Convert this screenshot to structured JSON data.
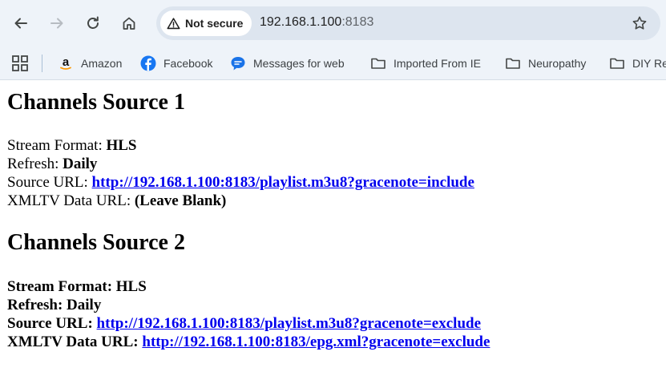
{
  "browser": {
    "security_label": "Not secure",
    "url_host": "192.168.1.100",
    "url_port": ":8183",
    "bookmarks": [
      {
        "label": "Amazon"
      },
      {
        "label": "Facebook"
      },
      {
        "label": "Messages for web"
      },
      {
        "label": "Imported From IE"
      },
      {
        "label": "Neuropathy"
      },
      {
        "label": "DIY Re"
      }
    ]
  },
  "sources": [
    {
      "heading": "Channels Source 1",
      "stream_format_label": "Stream Format: ",
      "stream_format_value": "HLS",
      "refresh_label": "Refresh: ",
      "refresh_value": "Daily",
      "source_url_label": "Source URL: ",
      "source_url_value": "http://192.168.1.100:8183/playlist.m3u8?gracenote=include",
      "xmltv_label": "XMLTV Data URL: ",
      "xmltv_value": "(Leave Blank)"
    },
    {
      "heading": "Channels Source 2",
      "stream_format_label": "Stream Format: ",
      "stream_format_value": "HLS",
      "refresh_label": "Refresh: ",
      "refresh_value": "Daily",
      "source_url_label": "Source URL: ",
      "source_url_value": "http://192.168.1.100:8183/playlist.m3u8?gracenote=exclude",
      "xmltv_label": "XMLTV Data URL: ",
      "xmltv_value": "http://192.168.1.100:8183/epg.xml?gracenote=exclude"
    }
  ],
  "colors": {
    "link": "#0000ee",
    "toolbar_bg": "#eef3f9",
    "omnibox_bg": "#dde5ef"
  }
}
